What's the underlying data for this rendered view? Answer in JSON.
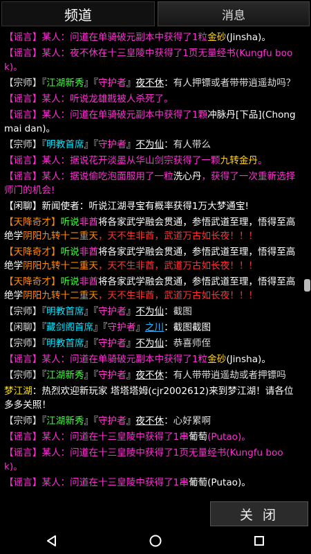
{
  "tabs": [
    {
      "label": "频道",
      "active": true
    },
    {
      "label": "消息",
      "active": false
    }
  ],
  "close_label": "关 闭",
  "nav": {
    "back": "back-icon",
    "home": "home-icon",
    "recents": "recents-icon"
  },
  "messages": [
    [
      [
        "【谣言】某人：问道在单骑破元副本中获得了1粒",
        "rumor"
      ],
      [
        "金砂",
        "gold"
      ],
      [
        "(Jinsha)。",
        "white"
      ]
    ],
    [
      [
        "【谣言】某人：夜不休在十三皇陵中获得了1页无量经书(Kungfu book)。",
        "rumor"
      ]
    ],
    [
      [
        "【宗师】『",
        "gray"
      ],
      [
        "江湖新秀",
        "green"
      ],
      [
        "』『",
        "gray"
      ],
      [
        "守护者",
        "magenta"
      ],
      [
        "』",
        "gray"
      ],
      [
        "夜不休",
        "name"
      ],
      [
        "：有人押镖或者带带逍遥劫吗？",
        "gray"
      ]
    ],
    [
      [
        "【谣言】某人：听说龙雄戡被人杀死了。",
        "rumor"
      ]
    ],
    [
      [
        "【谣言】某人：问道在单骑破元副本中获得了1颗",
        "rumor"
      ],
      [
        "冲脉丹[下品](Chongmai dan)。",
        "white"
      ]
    ],
    [
      [
        "【宗师】『",
        "gray"
      ],
      [
        "明教首席",
        "cyan"
      ],
      [
        "』『",
        "gray"
      ],
      [
        "守护者",
        "magenta"
      ],
      [
        "』",
        "gray"
      ],
      [
        "不为仙",
        "name"
      ],
      [
        "：有人带么",
        "gray"
      ]
    ],
    [
      [
        "【谣言】某人：据说花开淡墨从华山剑宗获得了一颗",
        "rumor"
      ],
      [
        "九转金丹",
        "gold"
      ],
      [
        "。",
        "rumor"
      ]
    ],
    [
      [
        "【谣言】某人：据说偷吃泡面服用了一粒",
        "rumor"
      ],
      [
        "洗心丹",
        "white"
      ],
      [
        "，获得了一次重新选择师门的机会!",
        "rumor"
      ]
    ],
    [
      [
        "【闲聊】新闻使者：听说江湖寻宝有概率获得1万大梦通宝!",
        "white"
      ]
    ],
    [
      [
        "【天降奇才】",
        "orange"
      ],
      [
        "听说",
        "green"
      ],
      [
        "非酋",
        "magenta"
      ],
      [
        "将各家武学融会贯通，参悟武道至理，悟得至高绝学",
        "white"
      ],
      [
        "阴阳九转十二重天",
        "orange"
      ],
      [
        "，天不生非酋，武道万古如长夜！！！",
        "red"
      ]
    ],
    [
      [
        "【天降奇才】",
        "orange"
      ],
      [
        "听说",
        "green"
      ],
      [
        "非酋",
        "magenta"
      ],
      [
        "将各家武学融会贯通，参悟武道至理，悟得至高绝学",
        "white"
      ],
      [
        "阴阳九转十二重天",
        "orange"
      ],
      [
        "，天不生非酋，武道万古如长夜！！！",
        "red"
      ]
    ],
    [
      [
        "【天降奇才】",
        "orange"
      ],
      [
        "听说",
        "green"
      ],
      [
        "非酋",
        "magenta"
      ],
      [
        "将各家武学融会贯通，参悟武道至理，悟得至高绝学",
        "white"
      ],
      [
        "阴阳九转十二重天",
        "orange"
      ],
      [
        "，天不生非酋，武道万古如长夜！！！",
        "red"
      ]
    ],
    [
      [
        "【宗师】『",
        "gray"
      ],
      [
        "明教首席",
        "cyan"
      ],
      [
        "』『",
        "gray"
      ],
      [
        "守护者",
        "magenta"
      ],
      [
        "』",
        "gray"
      ],
      [
        "不为仙",
        "name"
      ],
      [
        "：截图",
        "gray"
      ]
    ],
    [
      [
        "【闲聊】『",
        "gray"
      ],
      [
        "藏剑阁首席",
        "cyan"
      ],
      [
        "』『",
        "gray"
      ],
      [
        "守护者",
        "magenta"
      ],
      [
        "』",
        "gray"
      ],
      [
        "之川",
        "name-blue"
      ],
      [
        "：截图截图",
        "white"
      ]
    ],
    [
      [
        "【宗师】『",
        "gray"
      ],
      [
        "明教首席",
        "cyan"
      ],
      [
        "』『",
        "gray"
      ],
      [
        "守护者",
        "magenta"
      ],
      [
        "』",
        "gray"
      ],
      [
        "不为仙",
        "name"
      ],
      [
        "：恭喜师侄",
        "gray"
      ]
    ],
    [
      [
        "【谣言】某人：问道在单骑破元副本中获得了1粒",
        "rumor"
      ],
      [
        "金砂",
        "gold"
      ],
      [
        "(Jinsha)。",
        "white"
      ]
    ],
    [
      [
        "【宗师】『",
        "gray"
      ],
      [
        "江湖新秀",
        "green"
      ],
      [
        "』『",
        "gray"
      ],
      [
        "守护者",
        "magenta"
      ],
      [
        "』",
        "gray"
      ],
      [
        "夜不休",
        "name"
      ],
      [
        "：有人带带逍遥劫或者押镖吗",
        "gray"
      ]
    ],
    [
      [
        "梦江湖",
        "yellow"
      ],
      [
        "：热烈欢迎新玩家 塔塔塔姆(cjr2002612)来到梦江湖！请各位多多关照！",
        "white"
      ]
    ],
    [
      [
        "【宗师】『",
        "gray"
      ],
      [
        "江湖新秀",
        "green"
      ],
      [
        "』『",
        "gray"
      ],
      [
        "守护者",
        "magenta"
      ],
      [
        "』",
        "gray"
      ],
      [
        "夜不休",
        "name"
      ],
      [
        "：心好累啊",
        "gray"
      ]
    ],
    [
      [
        "【谣言】某人：问道在十三皇陵中获得了1串",
        "rumor"
      ],
      [
        "葡萄",
        "white"
      ],
      [
        "(Putao)。",
        "rumor"
      ]
    ],
    [
      [
        "【谣言】某人：问道在十三皇陵中获得了1页无量经书(Kungfu book)。",
        "rumor"
      ]
    ],
    [
      [
        "【谣言】某人：问道在十三皇陵中获得了1串",
        "rumor"
      ],
      [
        "葡萄",
        "white"
      ],
      [
        "(Putao)。",
        "white"
      ]
    ]
  ]
}
